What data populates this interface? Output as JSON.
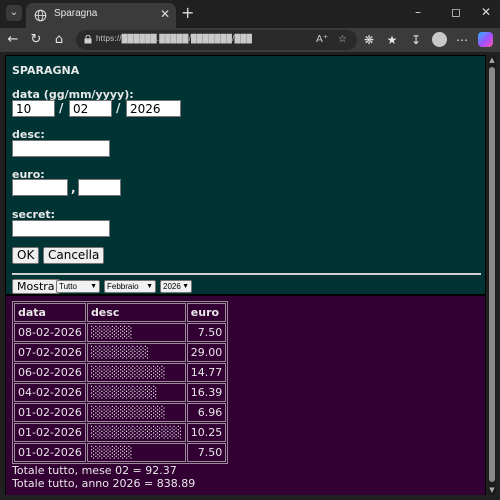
{
  "browser": {
    "tab_title": "Sparagna",
    "url": "https://██████.█████/███████/███"
  },
  "page": {
    "title": "SPARAGNA",
    "date_label": "data (gg/mm/yyyy):",
    "date_day": "10",
    "date_month": "02",
    "date_year": "2026",
    "date_sep": "/",
    "desc_label": "desc:",
    "desc_value": "",
    "euro_label": "euro:",
    "euro_int": "",
    "euro_sep": ",",
    "euro_dec": "",
    "secret_label": "secret:",
    "secret_value": "",
    "ok_button": "OK",
    "cancel_button": "Cancella",
    "show_button": "Mostra",
    "filter_type": "Tutto",
    "filter_month": "Febbraio",
    "filter_year": "2026"
  },
  "table": {
    "headers": [
      "data",
      "desc",
      "euro"
    ],
    "rows": [
      {
        "date": "08-02-2026",
        "desc": "░░░░░",
        "euro": "7.50"
      },
      {
        "date": "07-02-2026",
        "desc": "░░░░░░░",
        "euro": "29.00"
      },
      {
        "date": "06-02-2026",
        "desc": "░░░░░░░░░",
        "euro": "14.77"
      },
      {
        "date": "04-02-2026",
        "desc": "░░░░░░░░",
        "euro": "16.39"
      },
      {
        "date": "01-02-2026",
        "desc": "░░░░░░░░░",
        "euro": "6.96"
      },
      {
        "date": "01-02-2026",
        "desc": "░░░░░░░░░░░",
        "euro": "10.25"
      },
      {
        "date": "01-02-2026",
        "desc": "░░░░░",
        "euro": "7.50"
      }
    ],
    "total_month": "Totale tutto, mese 02 = 92.37",
    "total_year": "Totale tutto, anno 2026 = 838.89"
  }
}
